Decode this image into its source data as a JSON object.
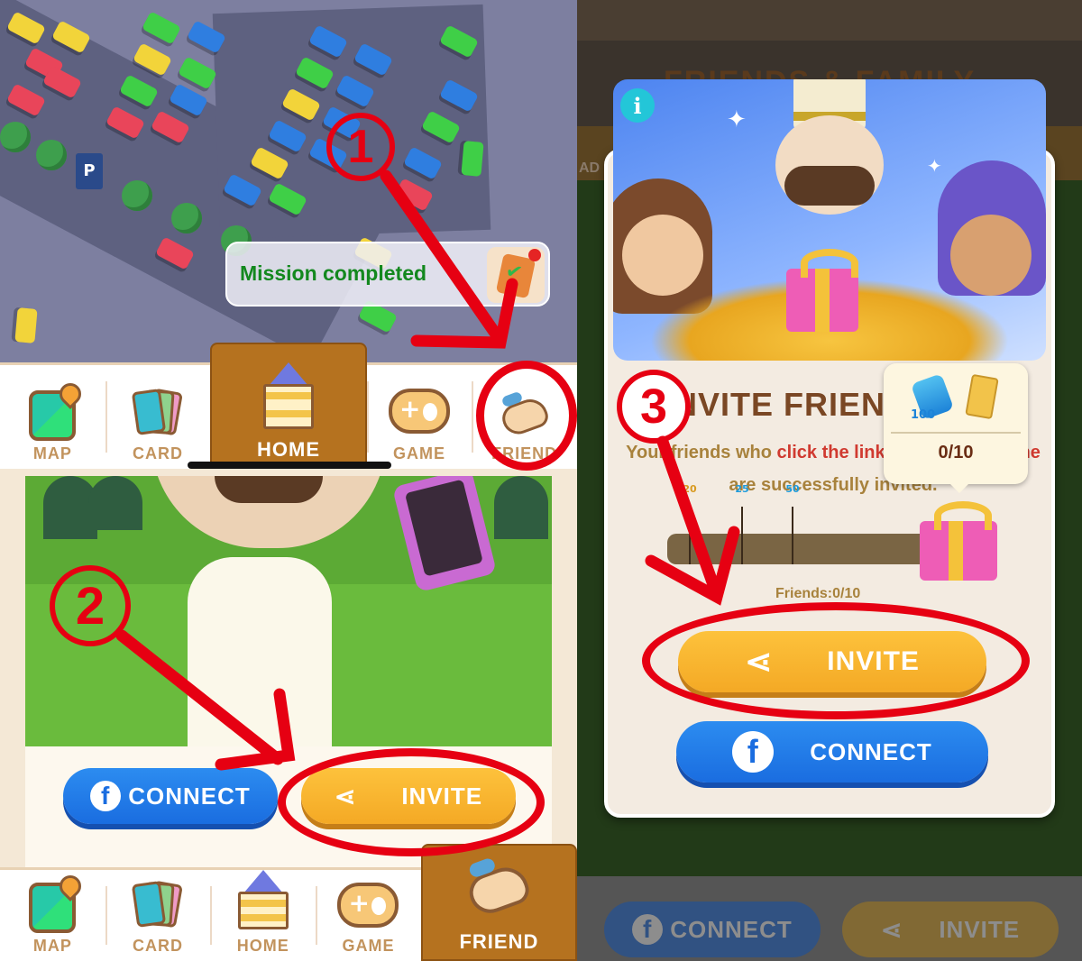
{
  "left_panel": {
    "notification": {
      "text": "Mission completed",
      "icon": "clipboard-check-icon"
    },
    "top_nav": {
      "active": "HOME",
      "items": [
        {
          "label": "MAP",
          "icon": "map-icon"
        },
        {
          "label": "CARD",
          "icon": "cards-icon"
        },
        {
          "label": "HOME",
          "icon": "castle-icon"
        },
        {
          "label": "GAME",
          "icon": "gamepad-icon"
        },
        {
          "label": "FRIEND",
          "icon": "handshake-icon"
        }
      ]
    },
    "buttons": {
      "connect": "CONNECT",
      "invite": "INVITE"
    },
    "bottom_nav": {
      "active": "FRIEND",
      "items": [
        {
          "label": "MAP",
          "icon": "map-icon"
        },
        {
          "label": "CARD",
          "icon": "cards-icon"
        },
        {
          "label": "HOME",
          "icon": "castle-icon"
        },
        {
          "label": "GAME",
          "icon": "gamepad-icon"
        },
        {
          "label": "FRIEND",
          "icon": "handshake-icon"
        }
      ]
    }
  },
  "right_panel": {
    "background_title": "FRIENDS & FAMILY",
    "background_side_label": "AD",
    "modal": {
      "title": "INVITE FRIENDS",
      "description_parts": [
        {
          "text": "Your friends who ",
          "highlight": false
        },
        {
          "text": "click the link to enter the game",
          "highlight": true
        },
        {
          "text": " are successfully invited.",
          "highlight": false
        }
      ],
      "milestones": [
        {
          "label": "20"
        },
        {
          "label": "25"
        },
        {
          "label": "50"
        }
      ],
      "progress": {
        "current": 0,
        "total": 10
      },
      "friends_label": "Friends:0/10",
      "tooltip": {
        "reward_amount": "100",
        "count": "0/10"
      },
      "invite_button": "INVITE",
      "connect_button": "CONNECT"
    },
    "background_buttons": {
      "connect": "CONNECT",
      "invite": "INVITE"
    }
  },
  "annotations": {
    "step1": "1",
    "step2": "2",
    "step3": "3",
    "color": "#e60012"
  }
}
